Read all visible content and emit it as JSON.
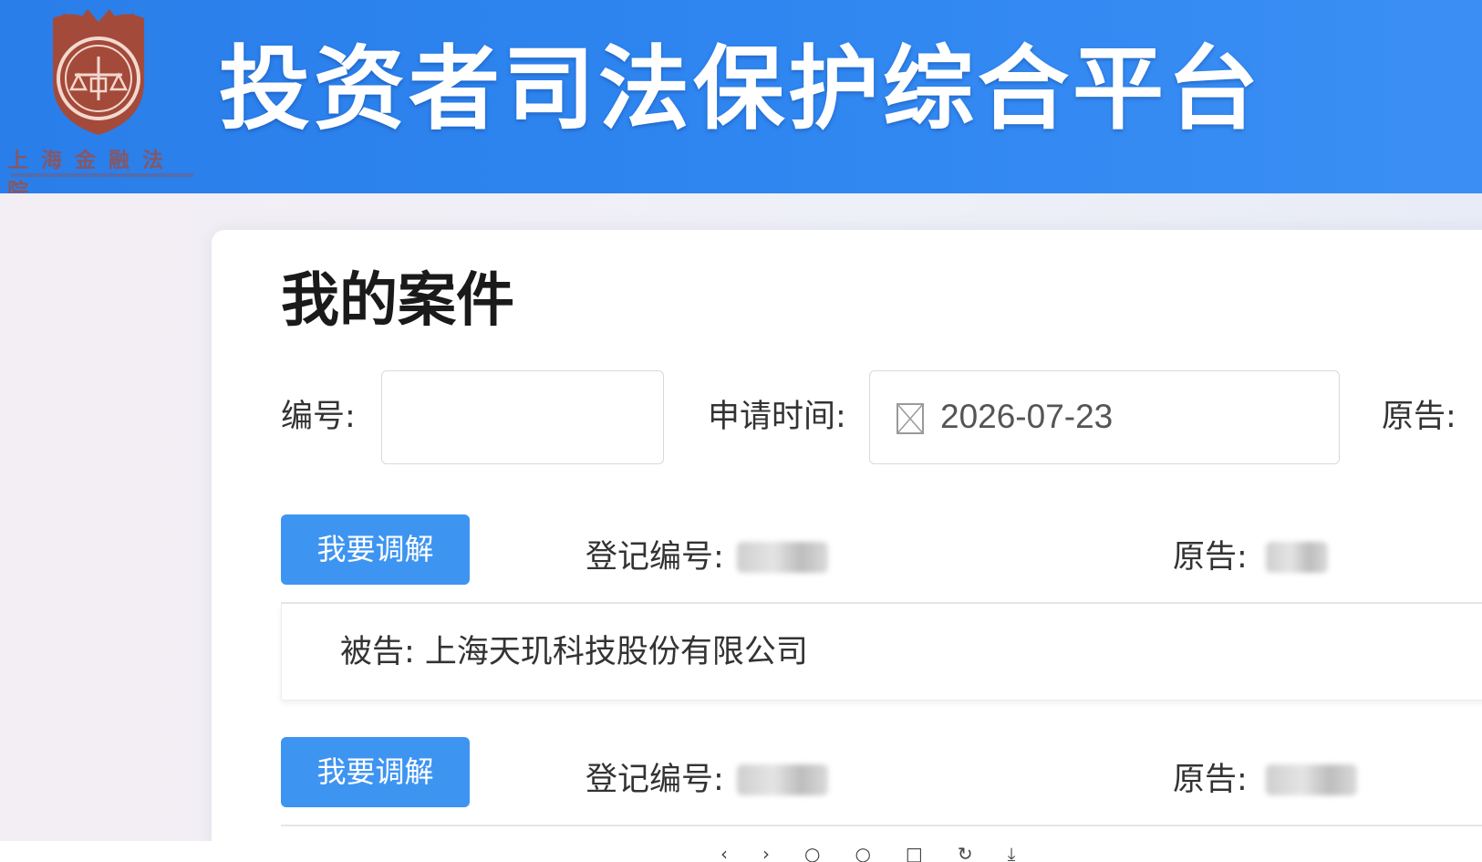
{
  "header": {
    "logo_text": "上海金融法院",
    "title": "投资者司法保护综合平台"
  },
  "main": {
    "page_title": "我的案件",
    "filters": {
      "number_label": "编号:",
      "number_value": "",
      "date_label": "申请时间:",
      "date_value": "2026-07-23",
      "plaintiff_label": "原告:"
    },
    "cases": [
      {
        "action_label": "我要调解",
        "reg_label": "登记编号:",
        "plaintiff_label": "原告:",
        "defendant_text": "被告: 上海天玑科技股份有限公司"
      },
      {
        "action_label": "我要调解",
        "reg_label": "登记编号:",
        "plaintiff_label": "原告:"
      }
    ]
  },
  "colors": {
    "header_blue": "#2f86f0",
    "button_blue": "#3e94f1",
    "logo_red": "#a44a3a"
  },
  "icons": {
    "logo": "court-emblem-icon",
    "date": "calendar-icon"
  }
}
